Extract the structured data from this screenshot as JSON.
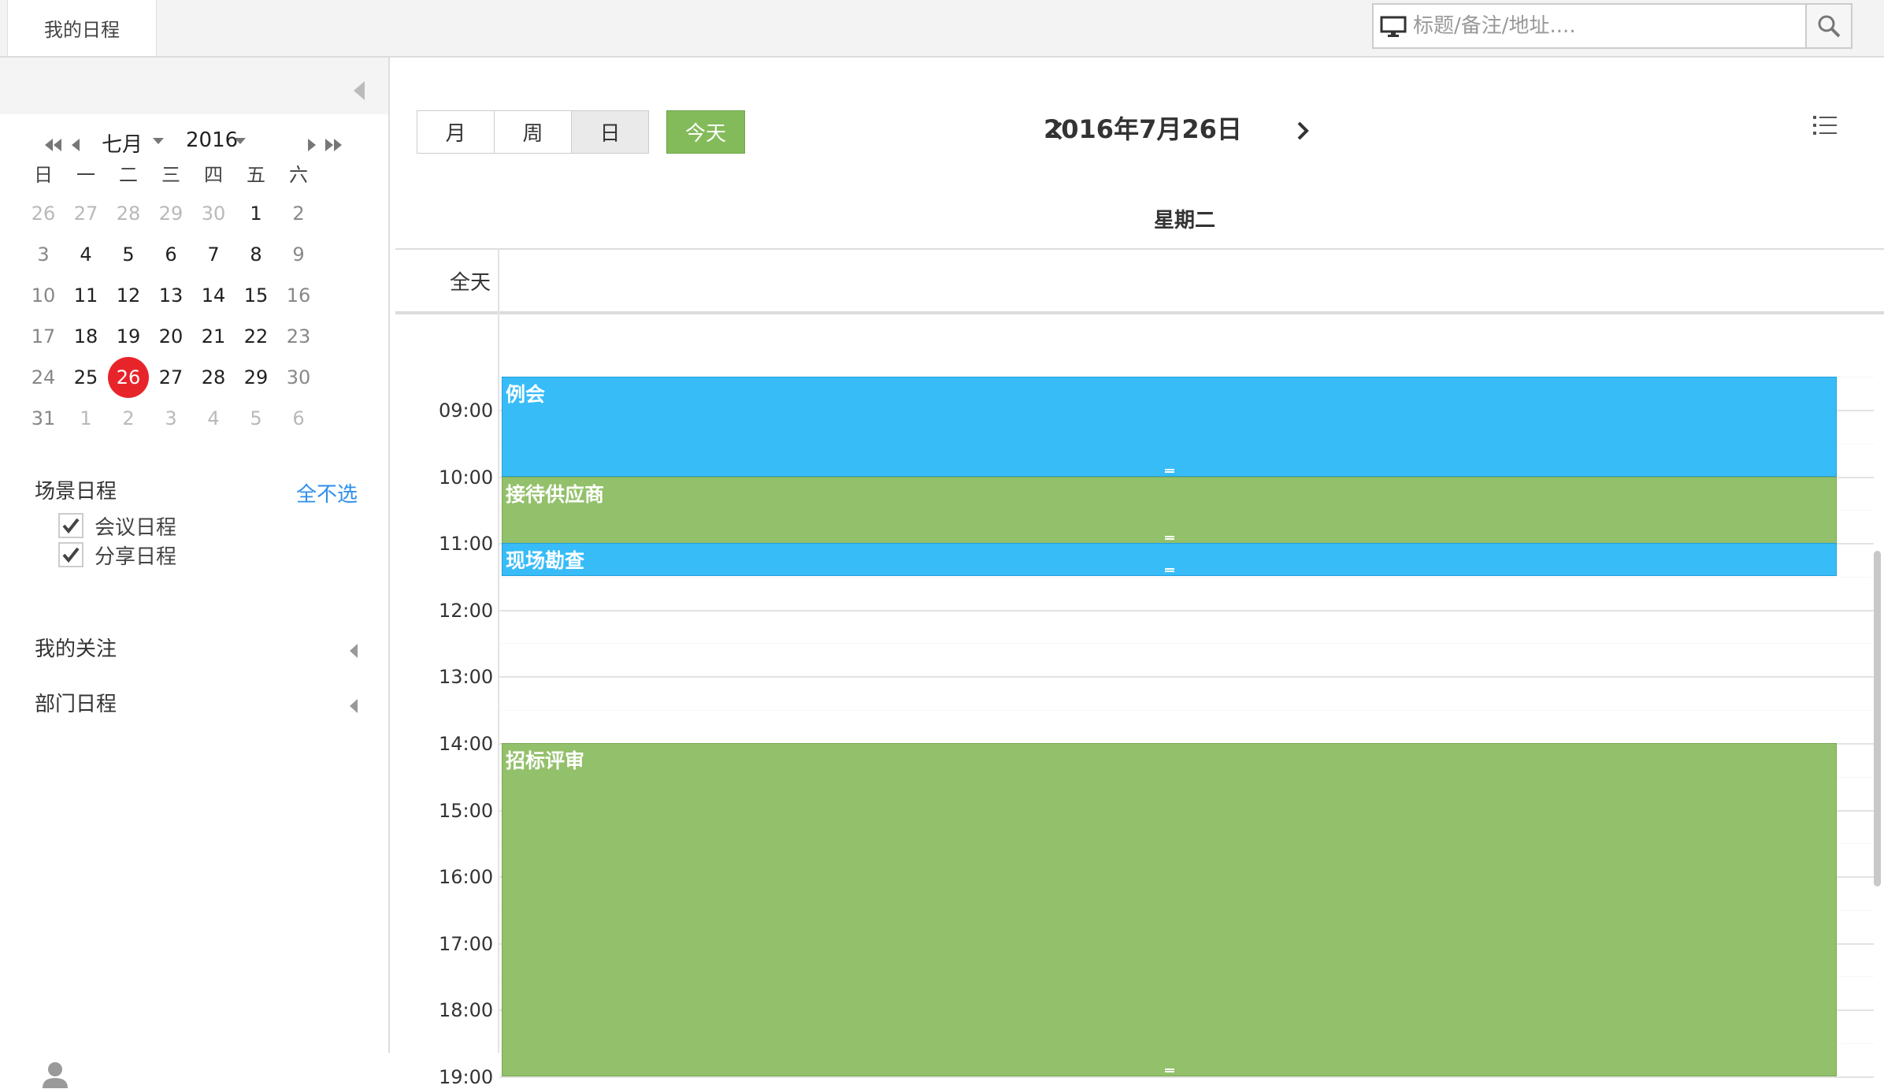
{
  "topbar": {
    "tab_label": "我的日程",
    "search_placeholder": "标题/备注/地址...."
  },
  "mini_calendar": {
    "month": "七月",
    "year": "2016",
    "weekdays": [
      "日",
      "一",
      "二",
      "三",
      "四",
      "五",
      "六"
    ],
    "weeks": [
      [
        "26",
        "27",
        "28",
        "29",
        "30",
        "1",
        "2"
      ],
      [
        "3",
        "4",
        "5",
        "6",
        "7",
        "8",
        "9"
      ],
      [
        "10",
        "11",
        "12",
        "13",
        "14",
        "15",
        "16"
      ],
      [
        "17",
        "18",
        "19",
        "20",
        "21",
        "22",
        "23"
      ],
      [
        "24",
        "25",
        "26",
        "27",
        "28",
        "29",
        "30"
      ],
      [
        "31",
        "1",
        "2",
        "3",
        "4",
        "5",
        "6"
      ]
    ],
    "selected_day": "26"
  },
  "sidebar": {
    "scene_title": "场景日程",
    "scene_toggle": "全不选",
    "scene_items": [
      {
        "label": "会议日程",
        "checked": true
      },
      {
        "label": "分享日程",
        "checked": true
      }
    ],
    "follow_title": "我的关注",
    "dept_title": "部门日程"
  },
  "toolbar": {
    "views": [
      "月",
      "周",
      "日"
    ],
    "active_view": "日",
    "today_label": "今天",
    "date_title": "2016年7月26日"
  },
  "day_view": {
    "weekday": "星期二",
    "allday_label": "全天",
    "hours": [
      "09:00",
      "10:00",
      "11:00",
      "12:00",
      "13:00",
      "14:00",
      "15:00",
      "16:00",
      "17:00",
      "18:00",
      "19:00"
    ],
    "events": [
      {
        "title": "例会",
        "start": "08:30",
        "end": "10:00",
        "color": "#38bcf8"
      },
      {
        "title": "接待供应商",
        "start": "10:00",
        "end": "11:00",
        "color": "#93c06a"
      },
      {
        "title": "现场勘查",
        "start": "11:00",
        "end": "11:30",
        "color": "#38bcf8"
      },
      {
        "title": "招标评审",
        "start": "14:00",
        "end": "19:00",
        "color": "#93c06a"
      }
    ]
  },
  "colors": {
    "accent_blue": "#38bcf8",
    "accent_green": "#93c06a",
    "today_red": "#e8242b",
    "link_blue": "#2e8fea"
  }
}
